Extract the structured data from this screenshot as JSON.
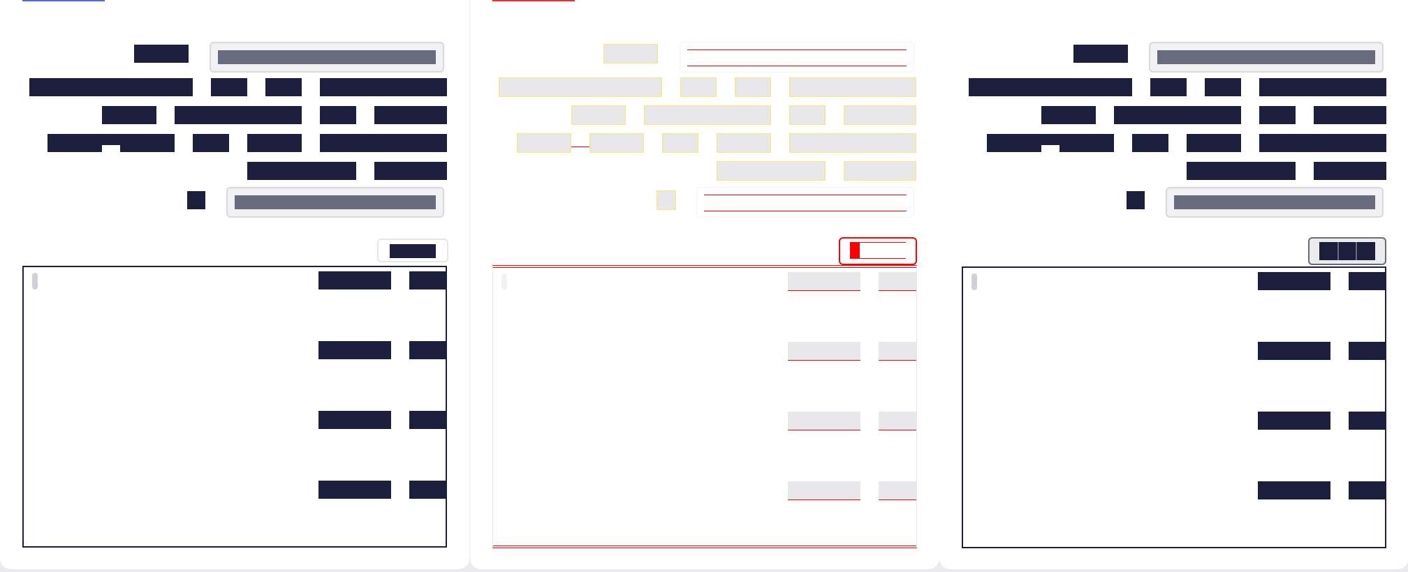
{
  "app": {
    "title": "",
    "panels": [
      {
        "label": "",
        "state": "original"
      },
      {
        "label": "",
        "state": "highlighted"
      },
      {
        "label": "",
        "state": "rendered"
      }
    ]
  },
  "colors": {
    "ink": "#1b1f3b",
    "field_fill": "#686a7e",
    "field_border": "#d9d9dd",
    "panel_bg": "#ffffff",
    "highlight_yellow": "#f4ec64",
    "highlight_red": "#ff0000",
    "placeholder_fill": "#e8e8ea",
    "tab_blue": "#5865d9",
    "tab_red": "#e23232"
  },
  "form": {
    "row1": {
      "label": "",
      "input_value": ""
    },
    "row5": {
      "label": "",
      "input_value": ""
    },
    "run_button_label": ""
  },
  "results": {
    "rows": [
      {
        "col1": "",
        "col2": ""
      },
      {
        "col1": "",
        "col2": ""
      },
      {
        "col1": "",
        "col2": ""
      },
      {
        "col1": "",
        "col2": ""
      }
    ]
  }
}
